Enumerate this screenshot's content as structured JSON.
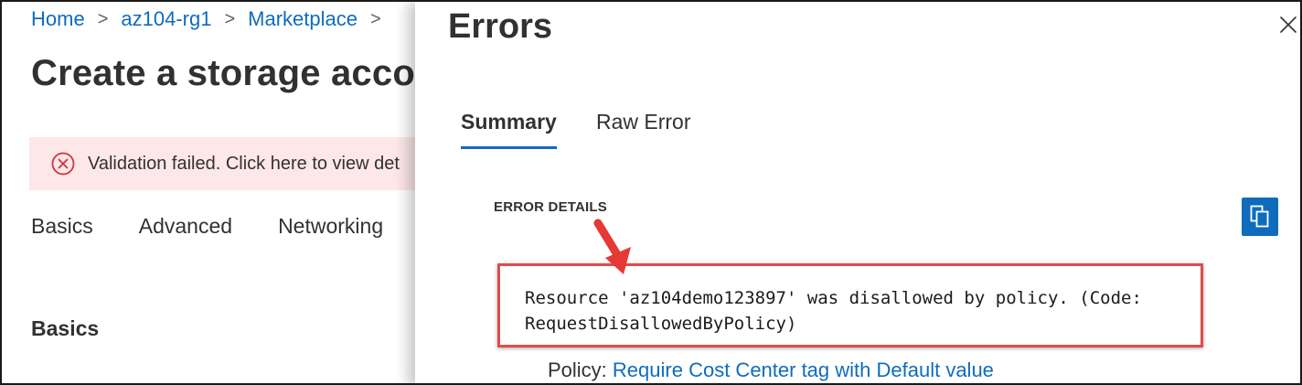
{
  "breadcrumb": [
    {
      "label": "Home"
    },
    {
      "label": "az104-rg1"
    },
    {
      "label": "Marketplace"
    }
  ],
  "page": {
    "title": "Create a storage accou",
    "validation_banner": "Validation failed. Click here to view det",
    "tabs": [
      "Basics",
      "Advanced",
      "Networking"
    ],
    "section_heading": "Basics"
  },
  "errors_panel": {
    "title": "Errors",
    "tabs": [
      {
        "label": "Summary",
        "selected": true
      },
      {
        "label": "Raw Error",
        "selected": false
      }
    ],
    "details_label": "ERROR DETAILS",
    "error_line1": "Resource 'az104demo123897' was disallowed by policy. (Code:",
    "error_line2": "RequestDisallowedByPolicy)",
    "policy_prefix": "Policy:",
    "policy_link": "Require Cost Center tag with Default value",
    "close_icon": "close-icon",
    "copy_icon": "copy-icon"
  },
  "colors": {
    "accent": "#0f6cbd",
    "error_red": "#d13438",
    "banner_bg": "#fde7e9",
    "highlight_red": "#e14b4b"
  }
}
